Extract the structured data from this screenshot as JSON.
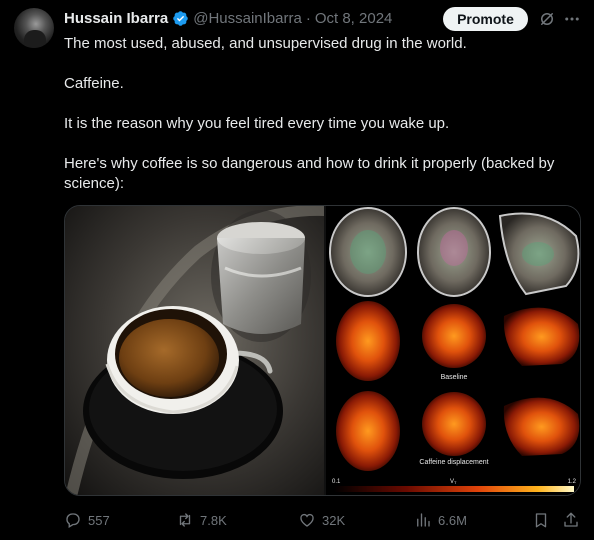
{
  "author": {
    "name": "Hussain Ibarra",
    "handle": "@HussainIbarra",
    "separator": "·",
    "date": "Oct 8, 2024"
  },
  "header": {
    "promote_label": "Promote"
  },
  "tweet": {
    "paragraphs": [
      "The most used, abused, and unsupervised drug in the world.",
      "Caffeine.",
      "It is the reason why you feel tired every time you wake up.",
      "Here's why coffee is so dangerous and how to drink it properly (backed by science):"
    ]
  },
  "media": {
    "scan_caption_1": "Baseline",
    "scan_caption_2": "Caffeine displacement",
    "colorbar_min": "0.1",
    "colorbar_mid": "V",
    "colorbar_mid_sub": "T",
    "colorbar_max": "1.2"
  },
  "actions": {
    "replies": "557",
    "reposts": "7.8K",
    "likes": "32K",
    "views": "6.6M"
  },
  "colors": {
    "background": "#000000",
    "text": "#e7e9ea",
    "muted": "#71767b",
    "verified": "#1d9bf0",
    "promote_bg": "#eff3f4"
  },
  "icons": [
    "verified-badge-icon",
    "grok-icon",
    "more-icon",
    "reply-icon",
    "repost-icon",
    "like-icon",
    "views-icon",
    "bookmark-icon",
    "share-icon"
  ]
}
